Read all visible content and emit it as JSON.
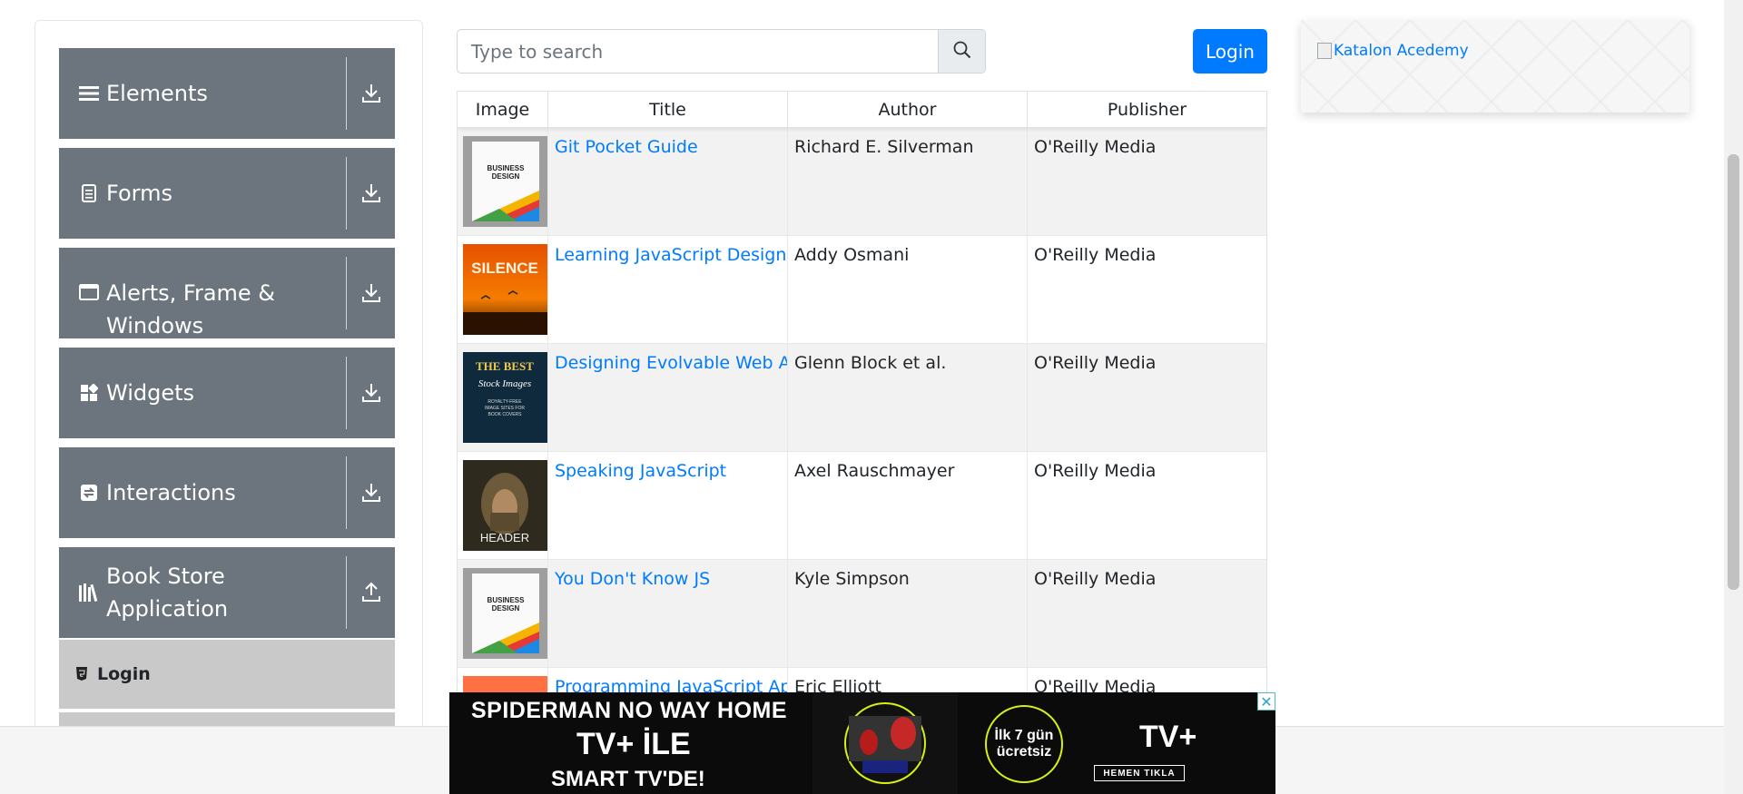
{
  "sidebar": {
    "groups": [
      {
        "label": "Elements",
        "icon": "menu-icon",
        "arrow": "download-icon"
      },
      {
        "label": "Forms",
        "icon": "document-icon",
        "arrow": "download-icon"
      },
      {
        "label": "Alerts, Frame & Windows",
        "icon": "window-icon",
        "arrow": "download-icon"
      },
      {
        "label": "Widgets",
        "icon": "widgets-icon",
        "arrow": "download-icon"
      },
      {
        "label": "Interactions",
        "icon": "interactions-icon",
        "arrow": "download-icon"
      },
      {
        "label": "Book Store Application",
        "icon": "books-icon",
        "arrow": "upload-icon"
      }
    ],
    "sub_items": [
      {
        "label": "Login",
        "icon": "html5-icon"
      }
    ]
  },
  "search": {
    "placeholder": "Type to search",
    "icon": "search-icon"
  },
  "header": {
    "login_label": "Login"
  },
  "ad_right": {
    "alt_text": "Katalon Acedemy"
  },
  "table": {
    "headers": [
      "Image",
      "Title",
      "Author",
      "Publisher"
    ],
    "rows": [
      {
        "title": "Git Pocket Guide",
        "author": "Richard E. Silverman",
        "publisher": "O'Reilly Media",
        "cover": "business-design-cover"
      },
      {
        "title": "Learning JavaScript Design Patterns",
        "author": "Addy Osmani",
        "publisher": "O'Reilly Media",
        "cover": "silence-cover"
      },
      {
        "title": "Designing Evolvable Web APIs with ASP.NET",
        "author": "Glenn Block et al.",
        "publisher": "O'Reilly Media",
        "cover": "best-stock-images-cover"
      },
      {
        "title": "Speaking JavaScript",
        "author": "Axel Rauschmayer",
        "publisher": "O'Reilly Media",
        "cover": "header-cover"
      },
      {
        "title": "You Don't Know JS",
        "author": "Kyle Simpson",
        "publisher": "O'Reilly Media",
        "cover": "business-design-cover"
      },
      {
        "title": "Programming JavaScript Applications",
        "author": "Eric Elliott",
        "publisher": "O'Reilly Media",
        "cover": "red-cover"
      }
    ]
  },
  "bottom_ad": {
    "line1": "SPIDERMAN NO WAY HOME",
    "line2": "TV+ İLE",
    "line3": "SMART TV'DE!",
    "circle_line1": "İlk 7 gün",
    "circle_line2": "ücretsiz",
    "logo": "TV+",
    "cta": "HEMEN TIKLA",
    "close": "✕"
  },
  "colors": {
    "sidebar_group_bg": "#6c757d",
    "sidebar_sub_bg": "#c9c9c9",
    "link": "#007bff",
    "primary_button": "#007bff"
  }
}
